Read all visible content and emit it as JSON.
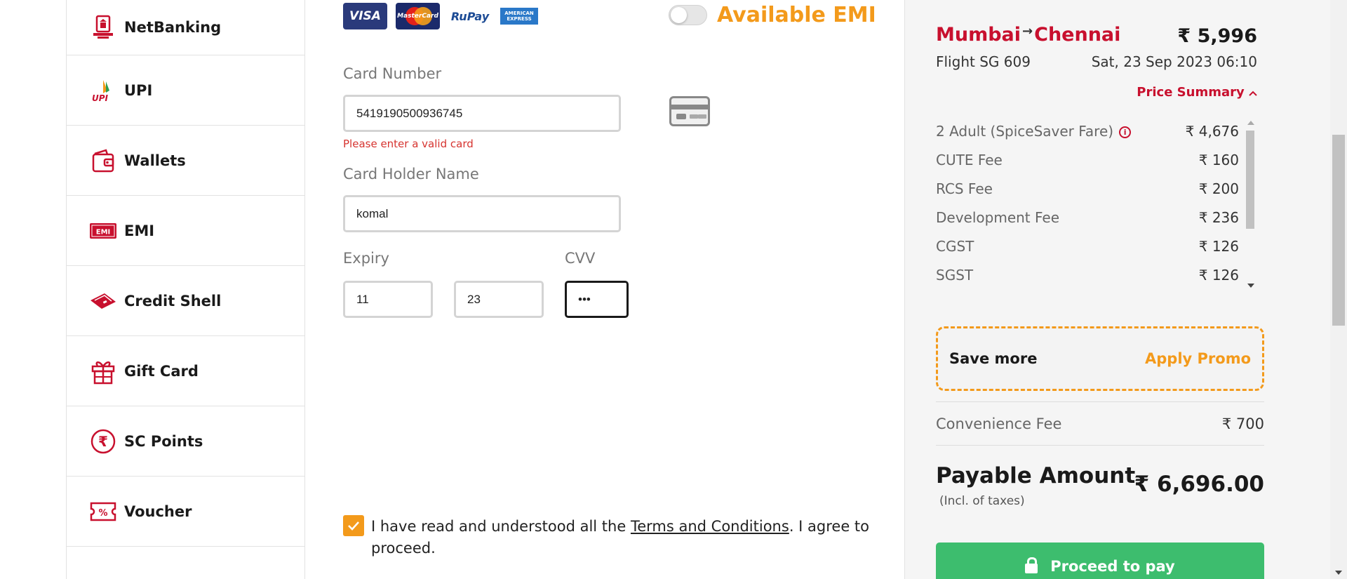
{
  "sidebar": {
    "items": [
      {
        "label": "NetBanking",
        "icon": "bank-icon"
      },
      {
        "label": "UPI",
        "icon": "upi-icon"
      },
      {
        "label": "Wallets",
        "icon": "wallet-icon"
      },
      {
        "label": "EMI",
        "icon": "emi-icon"
      },
      {
        "label": "Credit Shell",
        "icon": "credit-shell-icon"
      },
      {
        "label": "Gift Card",
        "icon": "gift-icon"
      },
      {
        "label": "SC Points",
        "icon": "rupee-coin-icon"
      },
      {
        "label": "Voucher",
        "icon": "voucher-icon"
      }
    ]
  },
  "card_form": {
    "logos": {
      "visa": "VISA",
      "mastercard": "MasterCard",
      "rupay": "RuPay",
      "amex_line1": "AMERICAN",
      "amex_line2": "EXPRESS"
    },
    "emi_label": "Available EMI",
    "emi_enabled": false,
    "card_number_label": "Card Number",
    "card_number_value": "5419190500936745",
    "card_number_error": "Please enter a valid card",
    "holder_label": "Card Holder Name",
    "holder_value": "komal",
    "expiry_label": "Expiry",
    "expiry_month": "11",
    "expiry_year": "23",
    "cvv_label": "CVV",
    "cvv_value": "•••",
    "terms_prefix": "I have read and understood all the ",
    "terms_link": "Terms and Conditions",
    "terms_suffix": ". I agree to proceed.",
    "terms_checked": true
  },
  "summary": {
    "from": "Mumbai",
    "arrow": "→",
    "to": "Chennai",
    "total_top": "₹ 5,996",
    "flight": "Flight  SG 609",
    "date": "Sat, 23 Sep 2023 06:10",
    "price_summary_label": "Price Summary",
    "fares": [
      {
        "label": "2 Adult  (SpiceSaver Fare)",
        "amount": "₹ 4,676"
      },
      {
        "label": "CUTE Fee",
        "amount": "₹ 160"
      },
      {
        "label": "RCS Fee",
        "amount": "₹ 200"
      },
      {
        "label": "Development Fee",
        "amount": "₹ 236"
      },
      {
        "label": "CGST",
        "amount": "₹ 126"
      },
      {
        "label": "SGST",
        "amount": "₹ 126"
      }
    ],
    "promo_left": "Save more",
    "promo_right": "Apply Promo",
    "convenience_label": "Convenience Fee",
    "convenience_amount": "₹ 700",
    "payable_label": "Payable Amount",
    "payable_sub": "(Incl. of taxes)",
    "payable_amount": "₹ 6,696.00",
    "proceed_label": "Proceed to pay"
  },
  "colors": {
    "brand_red": "#c8102e",
    "accent_orange": "#f39a1b",
    "pay_green": "#3dbd6e"
  }
}
